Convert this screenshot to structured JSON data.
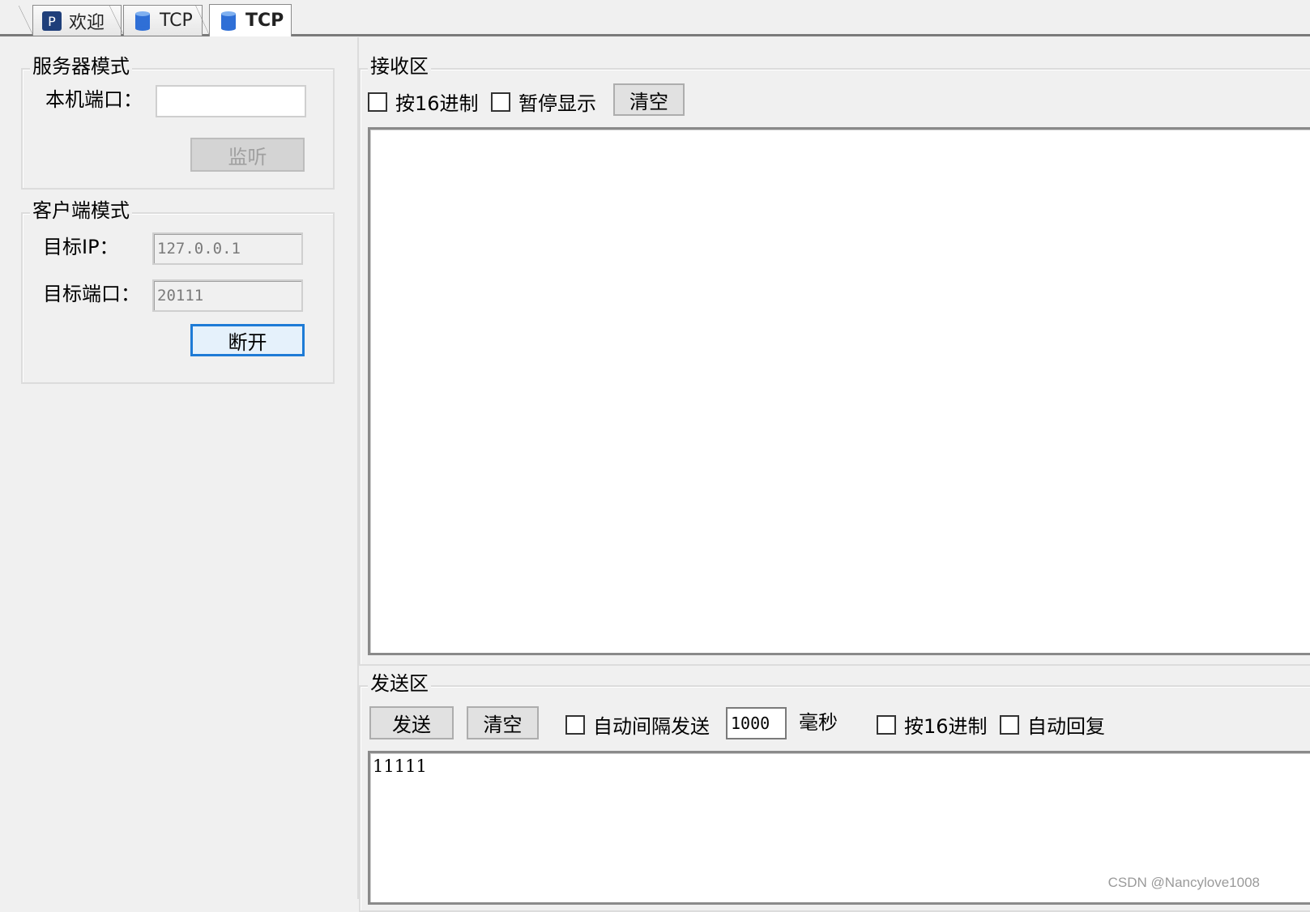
{
  "tabs": [
    {
      "label": "欢迎",
      "icon": "welcome-icon"
    },
    {
      "label": "TCP",
      "icon": "database-cylinder-icon"
    },
    {
      "label": "TCP",
      "icon": "database-cylinder-icon",
      "active": true
    }
  ],
  "server_mode": {
    "title": "服务器模式",
    "port_label": "本机端口：",
    "port_value": "",
    "listen_button": "监听"
  },
  "client_mode": {
    "title": "客户端模式",
    "ip_label": "目标IP：",
    "ip_value": "127.0.0.1",
    "port_label": "目标端口：",
    "port_value": "20111",
    "disconnect_button": "断开"
  },
  "receive": {
    "title": "接收区",
    "hex_label": "按16进制",
    "pause_label": "暂停显示",
    "clear_button": "清空",
    "content": ""
  },
  "send": {
    "title": "发送区",
    "send_button": "发送",
    "clear_button": "清空",
    "auto_interval_label": "自动间隔发送",
    "interval_value": "1000",
    "interval_unit": "毫秒",
    "hex_label": "按16进制",
    "auto_reply_label": "自动回复",
    "content": "11111"
  },
  "watermark": "CSDN @Nancylove1008",
  "colors": {
    "focus_border": "#1e7bd6",
    "tab_icon_blue": "#2f6fd6",
    "welcome_icon_bg": "#1f3f7a"
  }
}
